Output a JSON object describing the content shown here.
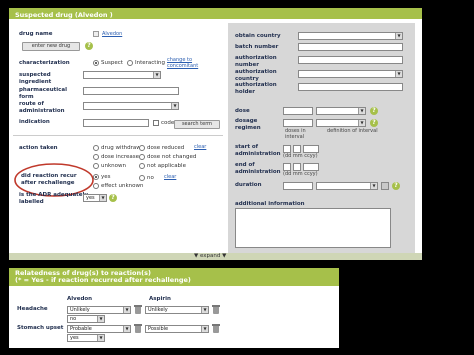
{
  "top_panel": {
    "title": "Suspected drug (Alvedon )",
    "drug_name": {
      "label": "drug name",
      "value": "Alvedon",
      "button": "enter new drug"
    },
    "characterization": {
      "label": "characterization",
      "options": [
        "Suspect",
        "Interacting"
      ],
      "selected": "Suspect",
      "link": "change to concomitant"
    },
    "suspected_ingredient": {
      "label": "suspected ingredient"
    },
    "pharmaceutical_form": {
      "label": "pharmaceutical form"
    },
    "route": {
      "label": "route of administration"
    },
    "indication": {
      "label": "indication",
      "code_label": "code",
      "button": "search term"
    },
    "action_taken": {
      "label": "action taken",
      "options": [
        "drug withdrawn",
        "dose reduced",
        "dose increased",
        "dose not changed",
        "unknown",
        "not applicable"
      ],
      "clear": "clear"
    },
    "rechallenge": {
      "label": "did reaction recur after rechallenge",
      "options": [
        "yes",
        "no",
        "effect unknown"
      ],
      "selected": "yes",
      "clear": "clear"
    },
    "adr_labelled": {
      "label": "is the ADR adequately labelled",
      "value": "yes"
    },
    "right": {
      "obtain_country": "obtain country",
      "batch_number": "batch number",
      "authorization_number": "authorization number",
      "authorization_country": "authorization country",
      "authorization_holder": "authorization holder",
      "dose": "dose",
      "dosage_regimen": "dosage regimen",
      "doses_in_interval": "doses in interval",
      "definition_of_interval": "definition of interval",
      "start_of_administration": "start of administration",
      "end_of_administration": "end of administration",
      "date_format": "(dd mm ccyy)",
      "date_format2": "(dd mm ccyy)",
      "duration": "duration",
      "additional_information": "additional information"
    },
    "expand": "expand"
  },
  "bottom_panel": {
    "title": "Relatedness of drug(s) to reaction(s)",
    "subtitle": "(* = Yes - if reaction recurred after rechallenge)",
    "columns": [
      "Alvedon",
      "Aspirin"
    ],
    "rows": [
      {
        "label": "Headache",
        "alvedon": "Unlikely",
        "alvedon_sub": "no",
        "aspirin": "Unlikely"
      },
      {
        "label": "Stomach upset",
        "alvedon": "Probable",
        "alvedon_sub": "yes",
        "aspirin": "Possible"
      }
    ]
  },
  "colors": {
    "accent": "#a6c04a",
    "label": "#1f2d4d",
    "highlight": "#c0392b"
  }
}
